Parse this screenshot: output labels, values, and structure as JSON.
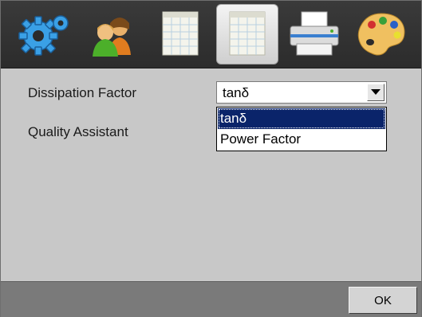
{
  "toolbar": {
    "icons": [
      "gear-icon",
      "users-icon",
      "calendar-icon",
      "calendar-icon",
      "printer-icon",
      "palette-icon"
    ],
    "selected": "calendar-icon-2"
  },
  "form": {
    "dissipation_label": "Dissipation Factor",
    "quality_label": "Quality Assistant",
    "combo_value": "tanδ",
    "options": [
      "tanδ",
      "Power Factor"
    ]
  },
  "footer": {
    "ok_label": "OK"
  },
  "colors": {
    "toolbar_bg": "#333333",
    "panel_bg": "#c8c8c8",
    "selection": "#0a246a",
    "footer_bg": "#7a7a7a"
  }
}
